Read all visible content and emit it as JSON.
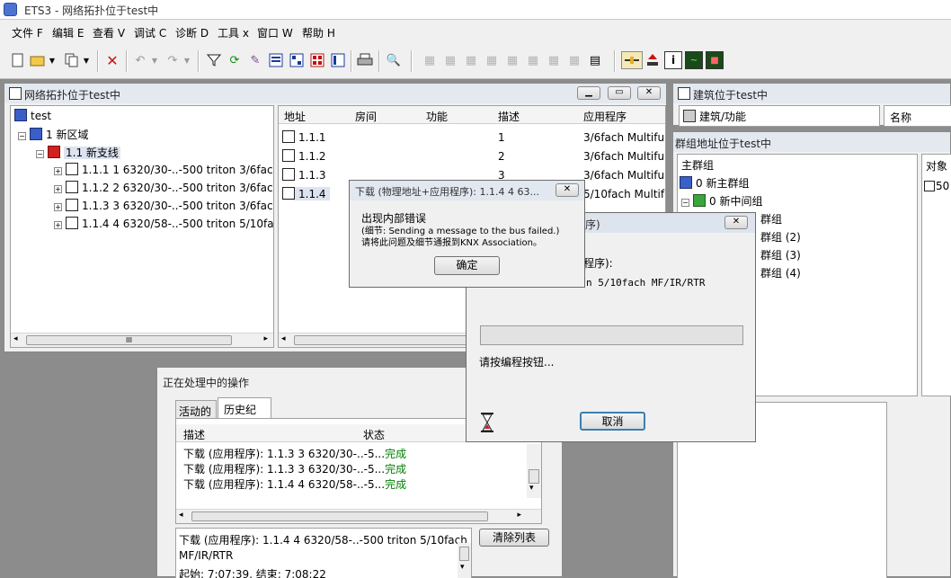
{
  "app": {
    "title": "ETS3 - 网络拓扑位于test中"
  },
  "menu": [
    "文件 F",
    "编辑 E",
    "查看 V",
    "调试 C",
    "诊断 D",
    "工具 x",
    "窗口 W",
    "帮助 H"
  ],
  "topology": {
    "title": "网络拓扑位于test中",
    "tree": [
      "test",
      "1 新区域",
      "1.1 新支线",
      "1.1.1 1 6320/30-..-500 triton 3/6fach",
      "1.1.2 2 6320/30-..-500 triton 3/6fach",
      "1.1.3 3 6320/30-..-500 triton 3/6fach",
      "1.1.4 4 6320/58-..-500 triton 5/10fac"
    ],
    "columns": [
      "地址",
      "房间",
      "功能",
      "描述",
      "应用程序"
    ],
    "rows": [
      {
        "addr": "1.1.1",
        "desc": "1",
        "app": "3/6fach Multifun"
      },
      {
        "addr": "1.1.2",
        "desc": "2",
        "app": "3/6fach Multifun"
      },
      {
        "addr": "1.1.3",
        "desc": "3",
        "app": "3/6fach Multifun"
      },
      {
        "addr": "1.1.4",
        "desc": "4",
        "app": "5/10fach Multifu"
      }
    ],
    "scroll_mark": "III"
  },
  "building": {
    "title": "建筑位于test中",
    "item": "建筑/功能",
    "col": "名称"
  },
  "groups": {
    "title": "群组地址位于test中",
    "items": [
      "主群组",
      "0 新主群组",
      "0 新中间组",
      "群组",
      "群组 (2)",
      "群组 (3)",
      "群组 (4)"
    ],
    "col": "对象",
    "obj": "50"
  },
  "ops": {
    "title": "正在处理中的操作",
    "tabs": [
      "活动的",
      "历史纪录"
    ],
    "columns": [
      "描述",
      "状态"
    ],
    "rows": [
      {
        "desc": "下载 (应用程序): 1.1.3 3 6320/30-..-5...",
        "status": "完成"
      },
      {
        "desc": "下载 (应用程序): 1.1.3 3 6320/30-..-5...",
        "status": "完成"
      },
      {
        "desc": "下载 (应用程序): 1.1.4 4 6320/58-..-5...",
        "status": "完成"
      }
    ],
    "detail_line1": "下载 (应用程序): 1.1.4 4 6320/58-..-500 triton 5/10fach",
    "detail_line2": "MF/IR/RTR",
    "detail_line3": "起始: 7:07:39, 结束: 7:08:22",
    "clear_label": "清除列表"
  },
  "progress_dialog": {
    "title_partial": "序)",
    "text1_partial": "程序):",
    "text2_partial": "n 5/10fach MF/IR/RTR",
    "prompt": "请按编程按钮...",
    "cancel": "取消"
  },
  "error_dialog": {
    "title": "下载 (物理地址+应用程序):  1.1.4 4 63...",
    "line1": "出现内部错误",
    "line2": "(细节: Sending a message to the bus failed.)",
    "line3": "请将此问题及细节通报到KNX Association。",
    "ok": "确定"
  }
}
